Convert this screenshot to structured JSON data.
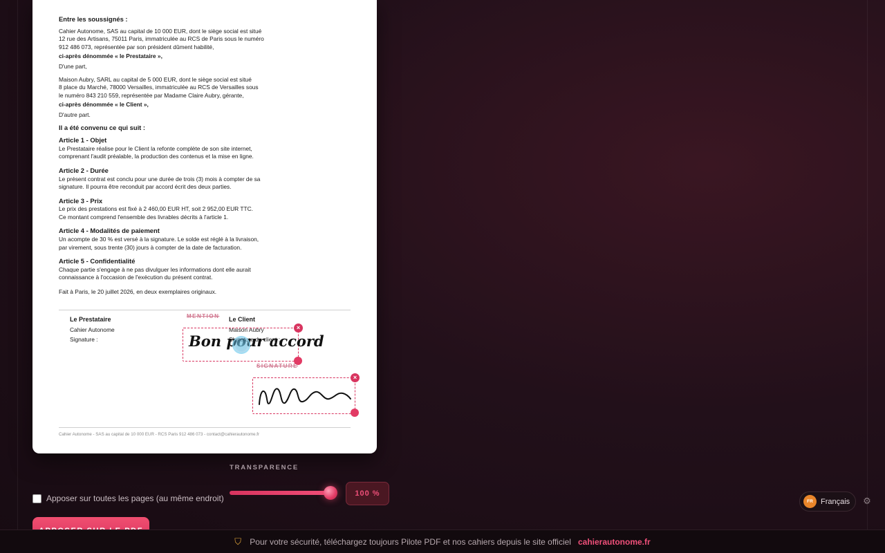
{
  "document": {
    "intro_heading": "Entre les soussignés :",
    "party1_lines": [
      "Cahier Autonome, SAS au capital de 10 000 EUR, dont le siège social est situé",
      "12 rue des Artisans, 75011 Paris, immatriculée au RCS de Paris sous le numéro",
      "912 486 073, représentée par son président dûment habilité,"
    ],
    "party1_alias": "ci-après dénommée « le Prestataire »,",
    "party1_end": "D'une part,",
    "party2_lines": [
      "Maison Aubry, SARL au capital de 5 000 EUR, dont le siège social est situé",
      "8 place du Marché, 78000 Versailles, immatriculée au RCS de Versailles sous",
      "le numéro 843 210 559, représentée par Madame Claire Aubry, gérante,"
    ],
    "party2_alias": "ci-après dénommée « le Client »,",
    "party2_end": "D'autre part.",
    "agreed_heading": "Il a été convenu ce qui suit :",
    "articles": [
      {
        "title": "Article 1 - Objet",
        "lines": [
          "Le Prestataire réalise pour le Client la refonte complète de son site internet,",
          "comprenant l'audit préalable, la production des contenus et la mise en ligne."
        ]
      },
      {
        "title": "Article 2 - Durée",
        "lines": [
          "Le présent contrat est conclu pour une durée de trois (3) mois à compter de sa",
          "signature. Il pourra être reconduit par accord écrit des deux parties."
        ]
      },
      {
        "title": "Article 3 - Prix",
        "lines": [
          "Le prix des prestations est fixé à 2 460,00 EUR HT, soit 2 952,00 EUR TTC.",
          "Ce montant comprend l'ensemble des livrables décrits à l'article 1."
        ]
      },
      {
        "title": "Article 4 - Modalités de paiement",
        "lines": [
          "Un acompte de 30 % est versé à la signature. Le solde est réglé à la livraison,",
          "par virement, sous trente (30) jours à compter de la date de facturation."
        ]
      },
      {
        "title": "Article 5 - Confidentialité",
        "lines": [
          "Chaque partie s'engage à ne pas divulguer les informations dont elle aurait",
          "connaissance à l'occasion de l'exécution du présent contrat."
        ]
      }
    ],
    "closing": "Fait à Paris, le 20 juillet 2026, en deux exemplaires originaux.",
    "sig_left": {
      "title": "Le Prestataire",
      "name": "Cahier Autonome",
      "label": "Signature :"
    },
    "sig_right": {
      "title": "Le Client",
      "name": "Maison Aubry",
      "label": "Signature du client :"
    },
    "footer": "Cahier Autonome - SAS au capital de 10 000 EUR - RCS Paris 912 486 073 - contact@cahierautonome.fr"
  },
  "overlays": {
    "mention": {
      "label": "MENTION",
      "text": "Bon pour accord",
      "close": "×"
    },
    "signature": {
      "label": "SIGNATURE",
      "close": "×"
    }
  },
  "controls": {
    "transparency_label": "TRANSPARENCE",
    "transparency_value": 100,
    "transparency_text": "100 %",
    "all_pages_label": "Apposer sur toutes les pages (au même endroit)",
    "all_pages_checked": false,
    "apply_button": "APPOSER SUR LE PDF"
  },
  "language": {
    "code": "FR",
    "name": "Français"
  },
  "security_bar": {
    "message": "Pour votre sécurité, téléchargez toujours Pilote PDF et nos cahiers depuis le site officiel",
    "link": "cahierautonome.fr"
  },
  "icons": {
    "close": "close-icon",
    "shield": "shield-icon",
    "gear": "gear-icon"
  },
  "colors": {
    "accent": "#e23a64",
    "background": "#1c0e15",
    "link": "#f0507a"
  }
}
